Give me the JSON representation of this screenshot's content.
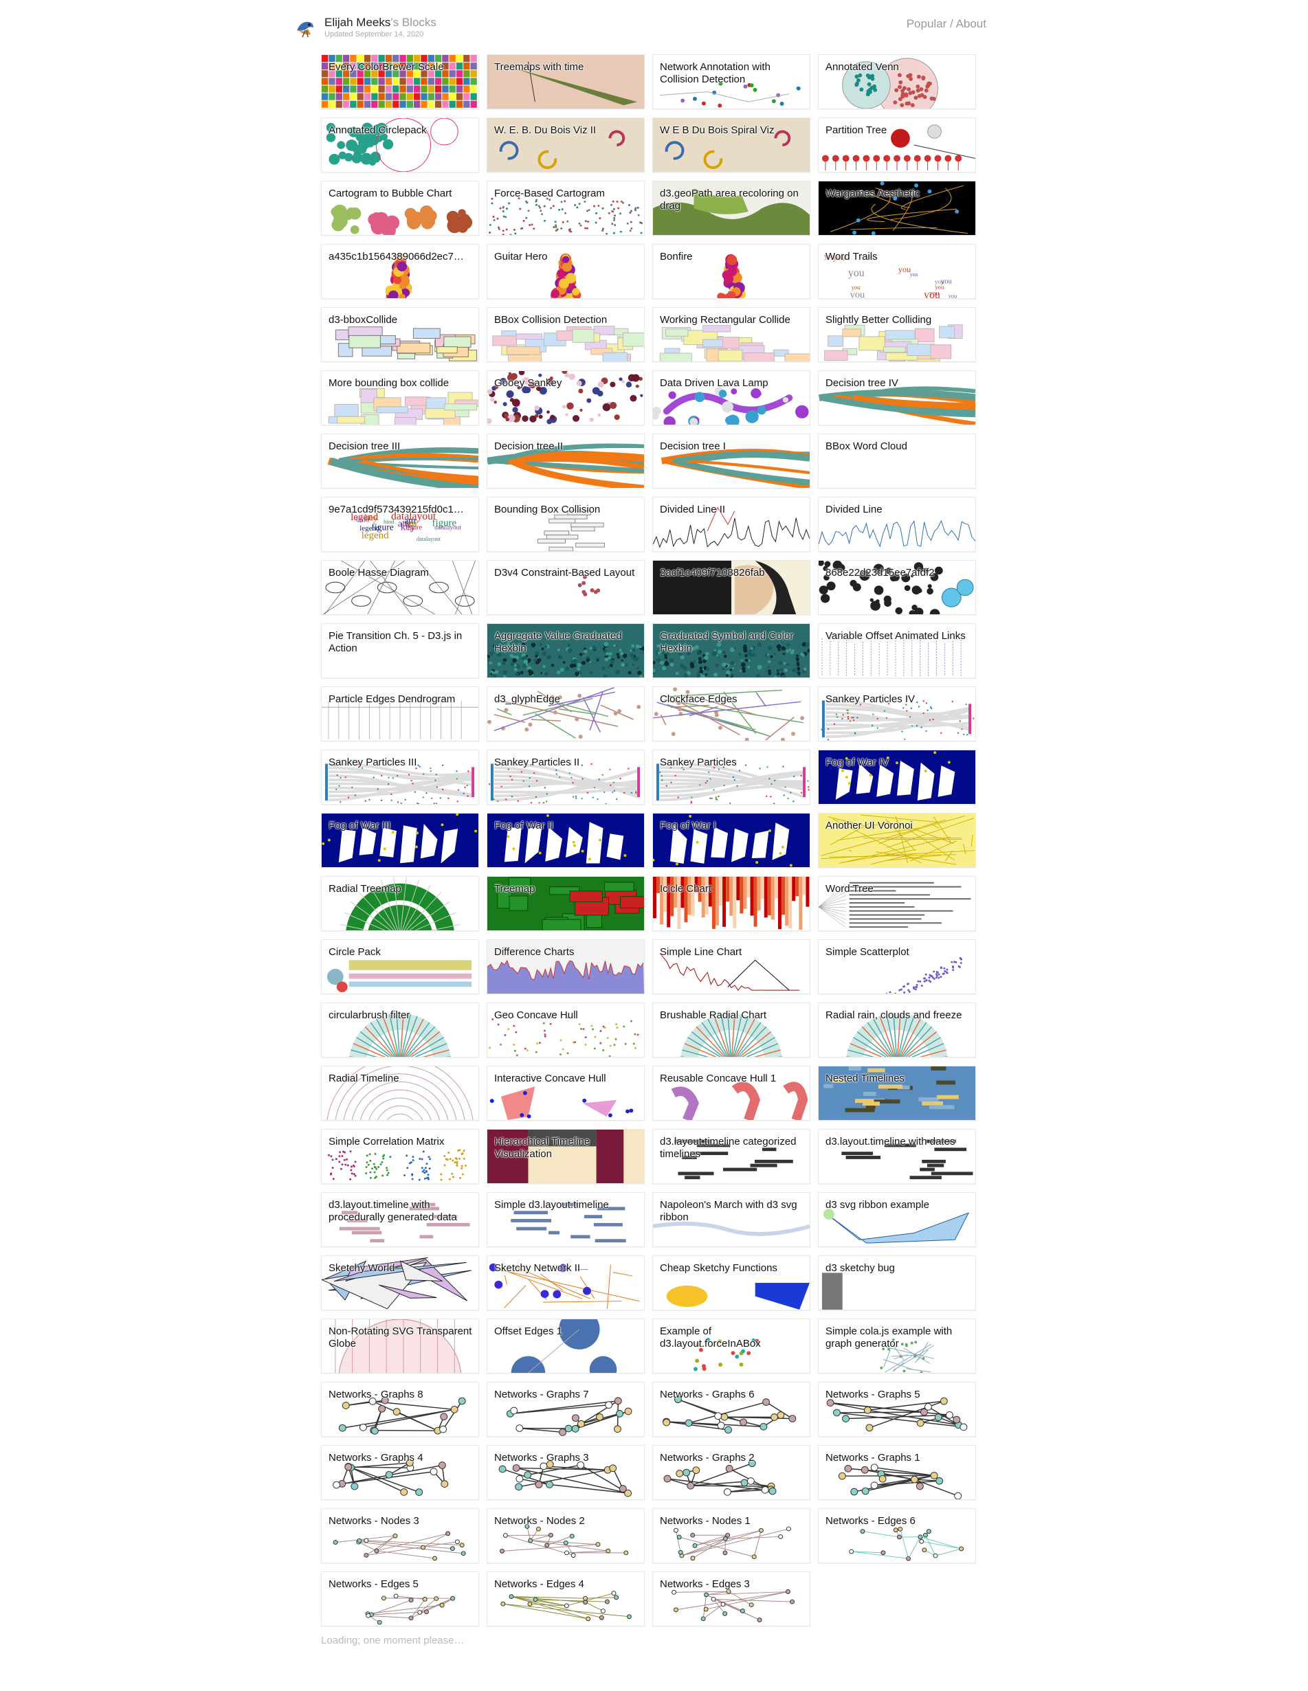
{
  "header": {
    "user_name": "Elijah Meeks",
    "title_suffix": "'s Blocks",
    "updated": "Updated September 14, 2020",
    "nav_popular": "Popular",
    "nav_separator": " / ",
    "nav_about": "About"
  },
  "blocks": [
    {
      "label": "Every ColorBrewer Scale",
      "theme": "colorbrewer"
    },
    {
      "label": "Treemaps with time",
      "theme": "treemaptime"
    },
    {
      "label": "Network Annotation with Collision Detection",
      "theme": "netannot"
    },
    {
      "label": "Annotated Venn",
      "theme": "venn"
    },
    {
      "label": "Annotated Circlepack",
      "theme": "circlepack"
    },
    {
      "label": "W. E. B. Du Bois Viz II",
      "theme": "dubois"
    },
    {
      "label": "W E B Du Bois Spiral Viz",
      "theme": "dubois"
    },
    {
      "label": "Partition Tree",
      "theme": "partition"
    },
    {
      "label": "Cartogram to Bubble Chart",
      "theme": "bubbles"
    },
    {
      "label": "Force-Based Cartogram",
      "theme": "forcecarto"
    },
    {
      "label": "d3.geoPath area recoloring on drag",
      "theme": "geomap"
    },
    {
      "label": "Wargames Aesthetic",
      "theme": "wargames"
    },
    {
      "label": "a435c1b1564389066d2ec7…",
      "theme": "flame"
    },
    {
      "label": "Guitar Hero",
      "theme": "flame2"
    },
    {
      "label": "Bonfire",
      "theme": "flame"
    },
    {
      "label": "Word Trails",
      "theme": "wordtrails"
    },
    {
      "label": "d3-bboxCollide",
      "theme": "boxes"
    },
    {
      "label": "BBox Collision Detection",
      "theme": "boxes2"
    },
    {
      "label": "Working Rectangular Collide",
      "theme": "boxes2"
    },
    {
      "label": "Slightly Better Colliding",
      "theme": "boxes3"
    },
    {
      "label": "More bounding box collide",
      "theme": "boxes4"
    },
    {
      "label": "Gooey Sankey",
      "theme": "gooey"
    },
    {
      "label": "Data Driven Lava Lamp",
      "theme": "lava"
    },
    {
      "label": "Decision tree IV",
      "theme": "dtree"
    },
    {
      "label": "Decision tree III",
      "theme": "dtree"
    },
    {
      "label": "Decision tree II",
      "theme": "dtree2"
    },
    {
      "label": "Decision tree I",
      "theme": "dtree2"
    },
    {
      "label": "BBox Word Cloud",
      "theme": "blank"
    },
    {
      "label": "9e7a1cd9f573439215fd0c1…",
      "theme": "wordcloud"
    },
    {
      "label": "Bounding Box Collision",
      "theme": "bbcoll"
    },
    {
      "label": "Divided Line II",
      "theme": "divline2"
    },
    {
      "label": "Divided Line",
      "theme": "divline"
    },
    {
      "label": "Boole Hasse Diagram",
      "theme": "hasse"
    },
    {
      "label": "D3v4 Constraint-Based Layout",
      "theme": "constraint"
    },
    {
      "label": "2acf1c409f7108826fab",
      "theme": "portrait"
    },
    {
      "label": "868e22d23d15ee7afdf2",
      "theme": "dots"
    },
    {
      "label": "Pie Transition Ch. 5 - D3.js in Action",
      "theme": "blank"
    },
    {
      "label": "Aggregate Value Graduated Hexbin",
      "theme": "hexbin"
    },
    {
      "label": "Graduated Symbol and Color Hexbin",
      "theme": "hexbin"
    },
    {
      "label": "Variable Offset Animated Links",
      "theme": "links"
    },
    {
      "label": "Particle Edges Dendrogram",
      "theme": "dendro"
    },
    {
      "label": "d3_glyphEdge",
      "theme": "glyph"
    },
    {
      "label": "Clockface Edges",
      "theme": "clockface"
    },
    {
      "label": "Sankey Particles IV",
      "theme": "sankey"
    },
    {
      "label": "Sankey Particles III",
      "theme": "sankey"
    },
    {
      "label": "Sankey Particles II",
      "theme": "sankey2"
    },
    {
      "label": "Sankey Particles",
      "theme": "sankey2"
    },
    {
      "label": "Fog of War IV",
      "theme": "fog"
    },
    {
      "label": "Fog of War III",
      "theme": "fog2"
    },
    {
      "label": "Fog of War II",
      "theme": "fog"
    },
    {
      "label": "Fog of War I",
      "theme": "fog3"
    },
    {
      "label": "Another UI Voronoi",
      "theme": "voronoi"
    },
    {
      "label": "Radial Treemap",
      "theme": "radialtree"
    },
    {
      "label": "Treemap",
      "theme": "treemap"
    },
    {
      "label": "Icicle Chart",
      "theme": "icicle"
    },
    {
      "label": "Word Tree",
      "theme": "wordtree"
    },
    {
      "label": "Circle Pack",
      "theme": "cpack"
    },
    {
      "label": "Difference Charts",
      "theme": "diff"
    },
    {
      "label": "Simple Line Chart",
      "theme": "linechart"
    },
    {
      "label": "Simple Scatterplot",
      "theme": "scatter"
    },
    {
      "label": "circularbrush filter",
      "theme": "circbrush"
    },
    {
      "label": "Geo Concave Hull",
      "theme": "geohull"
    },
    {
      "label": "Brushable Radial Chart",
      "theme": "circbrush"
    },
    {
      "label": "Radial rain, clouds and freeze",
      "theme": "circbrush"
    },
    {
      "label": "Radial Timeline",
      "theme": "radialtl"
    },
    {
      "label": "Interactive Concave Hull",
      "theme": "hull"
    },
    {
      "label": "Reusable Concave Hull 1",
      "theme": "hull2"
    },
    {
      "label": "Nested Timelines",
      "theme": "nestedtl"
    },
    {
      "label": "Simple Correlation Matrix",
      "theme": "corr"
    },
    {
      "label": "Hierarchical Timeline Visualization",
      "theme": "hiertl"
    },
    {
      "label": "d3.layout.timeline categorized timelines",
      "theme": "timeline"
    },
    {
      "label": "d3.layout.timeline with dates",
      "theme": "timeline2"
    },
    {
      "label": "d3.layout.timeline with procedurally generated data",
      "theme": "timeline3"
    },
    {
      "label": "Simple d3.layout.timeline",
      "theme": "timeline4"
    },
    {
      "label": "Napoleon's March with d3 svg ribbon",
      "theme": "ribbon"
    },
    {
      "label": "d3 svg ribbon example",
      "theme": "ribbon2"
    },
    {
      "label": "Sketchy World",
      "theme": "sketchworld"
    },
    {
      "label": "Sketchy Network II",
      "theme": "sketchnet"
    },
    {
      "label": "Cheap Sketchy Functions",
      "theme": "sketchfn"
    },
    {
      "label": "d3 sketchy bug",
      "theme": "sketchbug"
    },
    {
      "label": "Non-Rotating SVG Transparent Globe",
      "theme": "globe"
    },
    {
      "label": "Offset Edges 1",
      "theme": "offset"
    },
    {
      "label": "Example of d3.layout.forceInABox",
      "theme": "forcebox"
    },
    {
      "label": "Simple cola.js example with graph generator",
      "theme": "cola"
    },
    {
      "label": "Networks - Graphs 8",
      "theme": "net"
    },
    {
      "label": "Networks - Graphs 7",
      "theme": "net"
    },
    {
      "label": "Networks - Graphs 6",
      "theme": "net"
    },
    {
      "label": "Networks - Graphs 5",
      "theme": "net"
    },
    {
      "label": "Networks - Graphs 4",
      "theme": "net"
    },
    {
      "label": "Networks - Graphs 3",
      "theme": "net"
    },
    {
      "label": "Networks - Graphs 2",
      "theme": "net"
    },
    {
      "label": "Networks - Graphs 1",
      "theme": "net"
    },
    {
      "label": "Networks - Nodes 3",
      "theme": "netnodes"
    },
    {
      "label": "Networks - Nodes 2",
      "theme": "netnodes"
    },
    {
      "label": "Networks - Nodes 1",
      "theme": "netnodes"
    },
    {
      "label": "Networks - Edges 6",
      "theme": "netedges"
    },
    {
      "label": "Networks - Edges 5",
      "theme": "netnodes"
    },
    {
      "label": "Networks - Edges 4",
      "theme": "netedges2"
    },
    {
      "label": "Networks - Edges 3",
      "theme": "netnodes"
    }
  ],
  "loading_text": "Loading; one moment please…"
}
